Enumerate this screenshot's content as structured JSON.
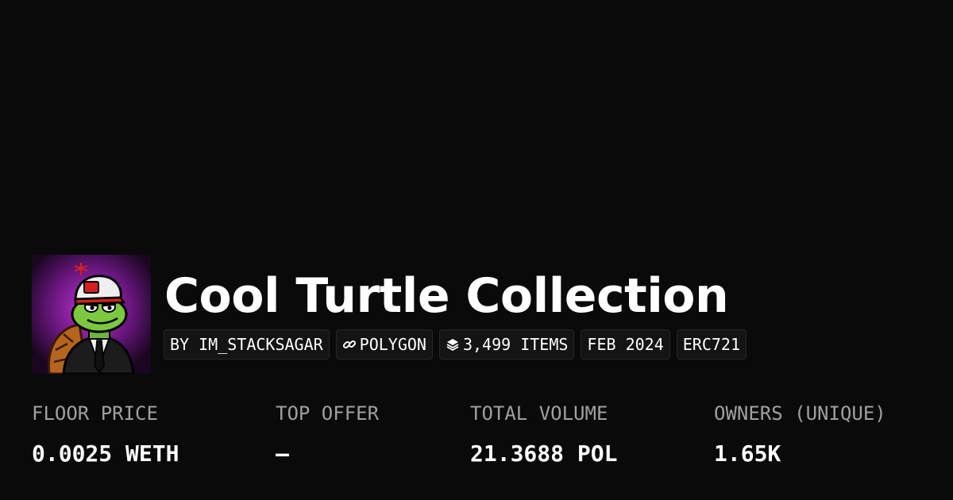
{
  "collection": {
    "title": "Cool Turtle Collection",
    "image_alt": "turtle-avatar"
  },
  "badges": [
    {
      "label": "BY IM_STACKSAGAR",
      "icon": ""
    },
    {
      "label": "POLYGON",
      "icon": "link-icon"
    },
    {
      "label": "3,499 ITEMS",
      "icon": "layers-icon"
    },
    {
      "label": "FEB 2024",
      "icon": ""
    },
    {
      "label": "ERC721",
      "icon": ""
    }
  ],
  "stats": [
    {
      "label": "FLOOR PRICE",
      "value": "0.0025 WETH"
    },
    {
      "label": "TOP OFFER",
      "value": "–"
    },
    {
      "label": "TOTAL VOLUME",
      "value": "21.3688 POL"
    },
    {
      "label": "OWNERS (UNIQUE)",
      "value": "1.65K"
    }
  ],
  "colors": {
    "background": "#0a0a0a",
    "badge_bg": "#141414",
    "label_gray": "#a0a0a0",
    "text": "#ffffff"
  }
}
